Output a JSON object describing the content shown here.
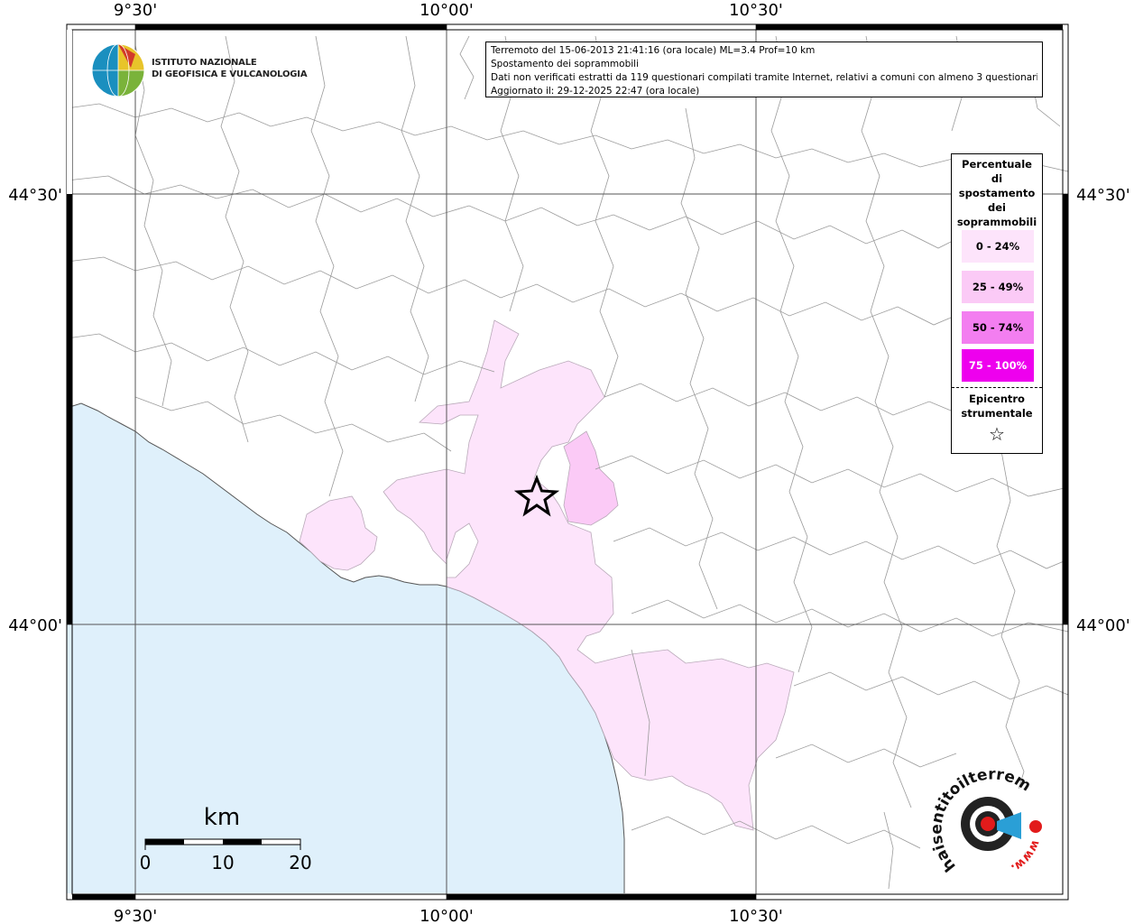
{
  "map": {
    "lon_labels": [
      "9°30'",
      "10°00'",
      "10°30'"
    ],
    "lat_labels": [
      "44°30'",
      "44°00'"
    ],
    "colors": {
      "sea": "#dff0fb",
      "land": "#ffffff",
      "boundary": "#9a9a9a",
      "class_0_24": "#fde4fb",
      "class_25_49": "#fbcaf6",
      "class_50_74": "#f37ef0",
      "class_75_100": "#ee00ee"
    }
  },
  "info": {
    "line1": "Terremoto del 15-06-2013 21:41:16 (ora locale) ML=3.4 Prof=10 km",
    "line2": "Spostamento dei soprammobili",
    "line3": "Dati non verificati estratti da 119 questionari compilati tramite Internet, relativi a comuni con almeno 3 questionari.",
    "line4": "Aggiornato il: 29-12-2025 22:47 (ora locale)"
  },
  "legend": {
    "title": [
      "Percentuale",
      "di",
      "spostamento",
      "dei",
      "soprammobili"
    ],
    "classes": [
      {
        "label": "0 - 24%",
        "color": "#fde4fb",
        "text_color": "#000000"
      },
      {
        "label": "25 - 49%",
        "color": "#fbcaf6",
        "text_color": "#000000"
      },
      {
        "label": "50 - 74%",
        "color": "#f37ef0",
        "text_color": "#000000"
      },
      {
        "label": "75 - 100%",
        "color": "#ee00ee",
        "text_color": "#ffffff"
      }
    ],
    "epicenter_label": [
      "Epicentro",
      "strumentale"
    ],
    "epicenter_symbol": "☆"
  },
  "scale": {
    "unit": "km",
    "ticks": [
      "0",
      "10",
      "20"
    ]
  },
  "logos": {
    "ingv_line1": "ISTITUTO NAZIONALE",
    "ingv_line2": "DI GEOFISICA E VULCANOLOGIA",
    "hsit_text": "haisentitoilterremoto.it",
    "hsit_url": "www."
  }
}
